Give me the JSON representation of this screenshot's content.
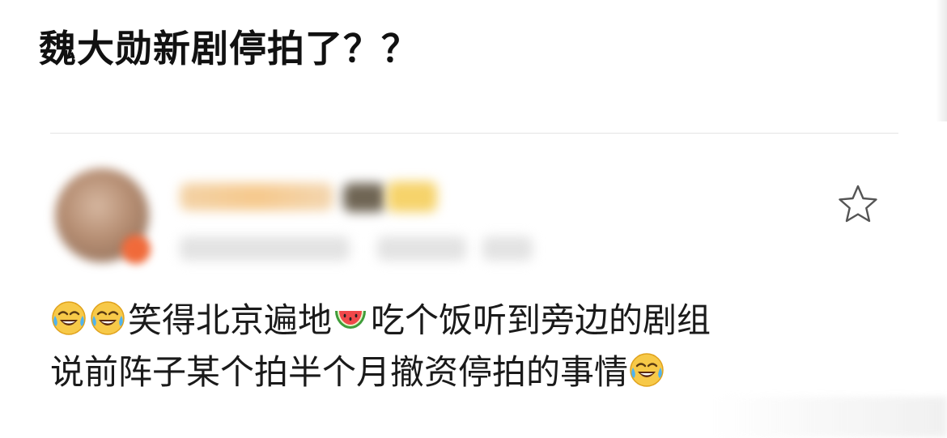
{
  "post": {
    "title": "魏大勋新剧停拍了？？"
  },
  "comment": {
    "star_icon": "star-outline-icon",
    "lines": [
      {
        "leading_emojis": [
          "laugh-cry-emoji-icon",
          "laugh-cry-emoji-icon"
        ],
        "text_a": "笑得北京遍地",
        "mid_emoji": "watermelon-emoji-icon",
        "text_b": "吃个饭听到旁边的剧组"
      },
      {
        "text": "说前阵子某个拍半个月撤资停拍的事情",
        "trailing_emoji": "laugh-cry-emoji-icon"
      }
    ]
  },
  "colors": {
    "text": "#1a1a1a",
    "divider": "#e4e4e4",
    "star_outline": "#555555"
  }
}
